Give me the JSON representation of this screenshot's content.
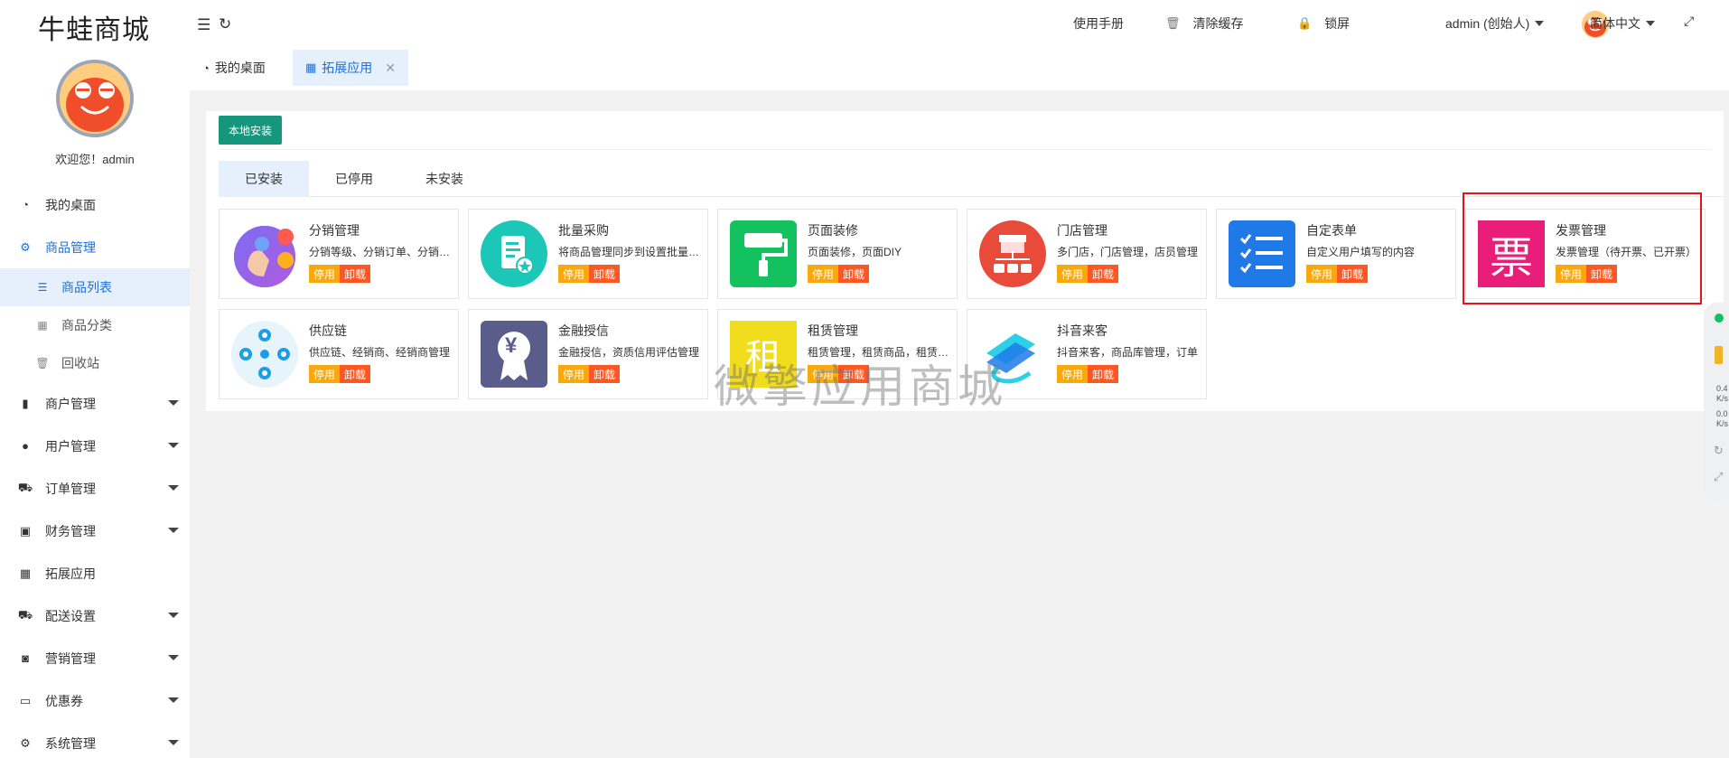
{
  "app": {
    "logo": "牛蛙商城",
    "welcome": "欢迎您！admin"
  },
  "sidebar": {
    "items": [
      {
        "label": "我的桌面",
        "icon": "dashboard-icon"
      },
      {
        "label": "商品管理",
        "icon": "goods-gear-icon"
      },
      {
        "label": "商品列表",
        "icon": "list-icon"
      },
      {
        "label": "商品分类",
        "icon": "grid-icon"
      },
      {
        "label": "回收站",
        "icon": "trash-icon"
      },
      {
        "label": "商户管理",
        "icon": "building-icon"
      },
      {
        "label": "用户管理",
        "icon": "user-icon"
      },
      {
        "label": "订单管理",
        "icon": "cart-icon"
      },
      {
        "label": "财务管理",
        "icon": "money-icon"
      },
      {
        "label": "拓展应用",
        "icon": "apps-icon"
      },
      {
        "label": "配送设置",
        "icon": "truck-icon"
      },
      {
        "label": "营销管理",
        "icon": "marketing-icon"
      },
      {
        "label": "优惠券",
        "icon": "coupon-icon"
      },
      {
        "label": "系统管理",
        "icon": "settings-icon"
      }
    ]
  },
  "topbar": {
    "manual": "使用手册",
    "clear_cache": "清除缓存",
    "lock": "锁屏",
    "user": "admin (创始人)",
    "language": "简体中文"
  },
  "tabs": [
    {
      "label": "我的桌面"
    },
    {
      "label": "拓展应用"
    }
  ],
  "content": {
    "install_button": "本地安装",
    "subtabs": [
      "已安装",
      "已停用",
      "未安装"
    ],
    "stop_label": "停用",
    "uninstall_label": "卸载",
    "apps": [
      {
        "name": "分销管理",
        "desc": "分销等级、分销订单、分销商管理"
      },
      {
        "name": "批量采购",
        "desc": "将商品管理同步到设置批量采购"
      },
      {
        "name": "页面装修",
        "desc": "页面装修，页面DIY"
      },
      {
        "name": "门店管理",
        "desc": "多门店，门店管理，店员管理"
      },
      {
        "name": "自定表单",
        "desc": "自定义用户填写的内容"
      },
      {
        "name": "发票管理",
        "desc": "发票管理（待开票、已开票）"
      },
      {
        "name": "供应链",
        "desc": "供应链、经销商、经销商管理"
      },
      {
        "name": "金融授信",
        "desc": "金融授信，资质信用评估管理"
      },
      {
        "name": "租赁管理",
        "desc": "租赁管理，租赁商品，租赁订单"
      },
      {
        "name": "抖音来客",
        "desc": "抖音来客，商品库管理，订单"
      }
    ],
    "invoice_glyph": "票",
    "rent_glyph": "租",
    "finance_glyph": "¥"
  },
  "watermark": "微擎应用商城",
  "float_bar": {
    "v1": "0.4",
    "u1": "K/s",
    "v2": "0.0",
    "u2": "K/s"
  },
  "colors": {
    "accent": "#1e6fd9",
    "install": "#15967d",
    "stop": "#f7a90f",
    "uninstall": "#ff5722",
    "highlight": "#e6131a"
  }
}
